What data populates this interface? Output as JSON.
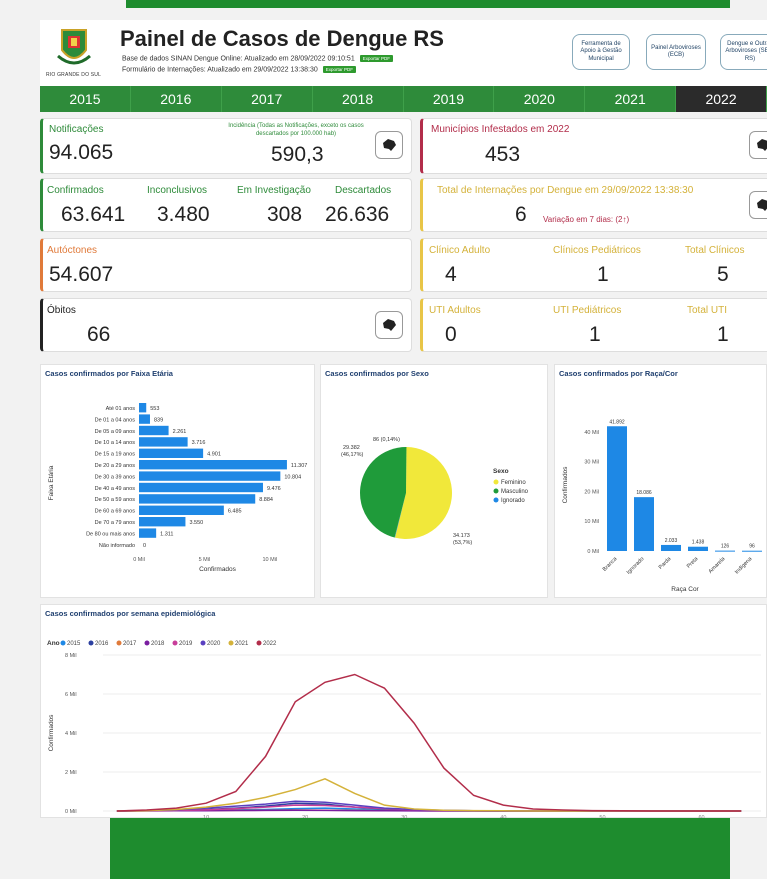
{
  "header": {
    "crest_text": "RIO GRANDE DO SUL",
    "title": "Painel de Casos de Dengue RS",
    "sub1": "Base de dados SINAN Dengue Online: Atualizado em 28/09/2022 09:10:51",
    "sub2": "Formulário de Internações: Atualizado em 29/09/2022 13:38:30",
    "pdf_label": "Exportar PDF",
    "links": [
      "Ferramenta de Apoio à Gestão Municipal",
      "Painel Arboviroses (ECB)",
      "Dengue e Outras Arboviroses (SES-RS)"
    ]
  },
  "years": [
    "2015",
    "2016",
    "2017",
    "2018",
    "2019",
    "2020",
    "2021",
    "2022"
  ],
  "active_year": "2022",
  "cards": {
    "notificacoes": {
      "label": "Notificações",
      "value": "94.065",
      "incidence_label": "Incidência (Todas as Notificações, exceto os casos descartados por 100.000 hab)",
      "incidence_value": "590,3"
    },
    "municipios": {
      "label": "Municípios Infestados em 2022",
      "value": "453"
    },
    "confirmados": {
      "label": "Confirmados",
      "value": "63.641"
    },
    "inconclusivos": {
      "label": "Inconclusivos",
      "value": "3.480"
    },
    "investigacao": {
      "label": "Em Investigação",
      "value": "308"
    },
    "descartados": {
      "label": "Descartados",
      "value": "26.636"
    },
    "internacoes": {
      "label": "Total de Internações por Dengue em 29/09/2022 13:38:30",
      "value": "6",
      "variacao": "Variação em 7 dias: (2↑)"
    },
    "autoctones": {
      "label": "Autóctones",
      "value": "54.607"
    },
    "clinico_adulto": {
      "label": "Clínico Adulto",
      "value": "4"
    },
    "clinicos_ped": {
      "label": "Clínicos Pediátricos",
      "value": "1"
    },
    "total_clinicos": {
      "label": "Total Clínicos",
      "value": "5"
    },
    "obitos": {
      "label": "Óbitos",
      "value": "66"
    },
    "uti_adultos": {
      "label": "UTI Adultos",
      "value": "0"
    },
    "uti_ped": {
      "label": "UTI Pediátricos",
      "value": "1"
    },
    "total_uti": {
      "label": "Total UTI",
      "value": "1"
    }
  },
  "colors": {
    "green": "#2e8b3a",
    "red": "#b22d4a",
    "orange": "#e07a3a",
    "yellow": "#e8c547",
    "bar": "#1e88e5"
  },
  "icons": {
    "map": "map-icon"
  },
  "chart_data": [
    {
      "type": "bar",
      "orientation": "horizontal",
      "title": "Casos confirmados por Faixa Etária",
      "xlabel": "Confirmados",
      "ylabel": "Faixa Etária",
      "categories": [
        "Até 01 anos",
        "De 01 a 04 anos",
        "De 05 a 09 anos",
        "De 10 a 14 anos",
        "De 15 a 19 anos",
        "De 20 a 29 anos",
        "De 30 a 39 anos",
        "De 40 a 49 anos",
        "De 50 a 59 anos",
        "De 60 a 69 anos",
        "De 70 a 79 anos",
        "De 80 ou mais anos",
        "Não informado"
      ],
      "values": [
        553,
        839,
        2261,
        3716,
        4901,
        11307,
        10804,
        9476,
        8884,
        6485,
        3550,
        1311,
        0
      ],
      "value_labels": [
        "553",
        "839",
        "2.261",
        "3.716",
        "4.901",
        "11.307",
        "10.804",
        "9.476",
        "8.884",
        "6.485",
        "3.550",
        "1.311",
        "0"
      ],
      "xticks": [
        "0 Mil",
        "5 Mil",
        "10 Mil"
      ],
      "xlim": [
        0,
        12000
      ]
    },
    {
      "type": "pie",
      "title": "Casos confirmados por Sexo",
      "legend_title": "Sexo",
      "slices": [
        {
          "name": "Feminino",
          "value": 34173,
          "label": "34.173\n(53,7%)",
          "color": "#f1e83a"
        },
        {
          "name": "Masculino",
          "value": 29382,
          "label": "29.382\n(46,17%)",
          "color": "#1f9b3a"
        },
        {
          "name": "Ignorado",
          "value": 86,
          "label": "86 (0,14%)",
          "color": "#1e88e5"
        }
      ]
    },
    {
      "type": "bar",
      "title": "Casos confirmados por Raça/Cor",
      "xlabel": "Raça Cor",
      "ylabel": "Confirmados",
      "categories": [
        "Branca",
        "Ignorado",
        "Parda",
        "Preta",
        "Amarela",
        "Indígena"
      ],
      "values": [
        41892,
        18086,
        2033,
        1438,
        126,
        96
      ],
      "value_labels": [
        "41.892",
        "18.086",
        "2.033",
        "1.438",
        "126",
        "96"
      ],
      "yticks": [
        "0 Mil",
        "10 Mil",
        "20 Mil",
        "30 Mil",
        "40 Mil"
      ],
      "ylim": [
        0,
        45000
      ]
    },
    {
      "type": "line",
      "title": "Casos confirmados por semana epidemiológica",
      "legend_title": "Ano",
      "ylabel": "Confirmados",
      "yticks": [
        "0 Mil",
        "2 Mil",
        "4 Mil",
        "6 Mil",
        "8 Mil"
      ],
      "ylim": [
        0,
        8000
      ],
      "xticks": [
        "10",
        "20",
        "30",
        "40",
        "50",
        "60"
      ],
      "x": [
        1,
        4,
        7,
        10,
        13,
        16,
        19,
        22,
        25,
        28,
        31,
        34,
        37,
        40,
        43,
        46,
        49,
        52,
        55,
        58,
        61,
        64
      ],
      "series": [
        {
          "name": "2015",
          "color": "#1e88e5",
          "values": [
            0,
            10,
            20,
            40,
            60,
            80,
            120,
            150,
            100,
            60,
            30,
            10,
            5,
            0,
            0,
            0,
            0,
            0,
            0,
            0,
            0,
            0
          ]
        },
        {
          "name": "2016",
          "color": "#2b3fa0",
          "values": [
            0,
            20,
            40,
            80,
            150,
            250,
            400,
            350,
            200,
            100,
            50,
            20,
            10,
            0,
            0,
            0,
            0,
            0,
            0,
            0,
            0,
            0
          ]
        },
        {
          "name": "2017",
          "color": "#e07a3a",
          "values": [
            0,
            5,
            10,
            20,
            30,
            40,
            50,
            40,
            30,
            20,
            10,
            5,
            0,
            0,
            0,
            0,
            0,
            0,
            0,
            0,
            0,
            0
          ]
        },
        {
          "name": "2018",
          "color": "#7a1ea0",
          "values": [
            0,
            5,
            10,
            15,
            25,
            30,
            40,
            30,
            20,
            10,
            5,
            0,
            0,
            0,
            0,
            0,
            0,
            0,
            0,
            0,
            0,
            0
          ]
        },
        {
          "name": "2019",
          "color": "#c83e9a",
          "values": [
            0,
            10,
            30,
            60,
            120,
            200,
            300,
            280,
            200,
            120,
            60,
            20,
            10,
            0,
            0,
            0,
            0,
            0,
            0,
            0,
            0,
            0
          ]
        },
        {
          "name": "2020",
          "color": "#5a40c0",
          "values": [
            0,
            20,
            60,
            150,
            250,
            350,
            500,
            450,
            300,
            150,
            80,
            30,
            10,
            0,
            0,
            0,
            0,
            0,
            0,
            0,
            0,
            0
          ]
        },
        {
          "name": "2021",
          "color": "#d4b23a",
          "values": [
            0,
            20,
            80,
            200,
            400,
            700,
            1100,
            1650,
            900,
            300,
            100,
            40,
            20,
            10,
            0,
            0,
            0,
            0,
            0,
            0,
            0,
            0
          ]
        },
        {
          "name": "2022",
          "color": "#b22d4a",
          "values": [
            0,
            50,
            150,
            400,
            1000,
            2800,
            5600,
            6600,
            7000,
            6300,
            4500,
            2200,
            800,
            300,
            100,
            50,
            20,
            10,
            0,
            0,
            0,
            0
          ]
        }
      ]
    }
  ]
}
